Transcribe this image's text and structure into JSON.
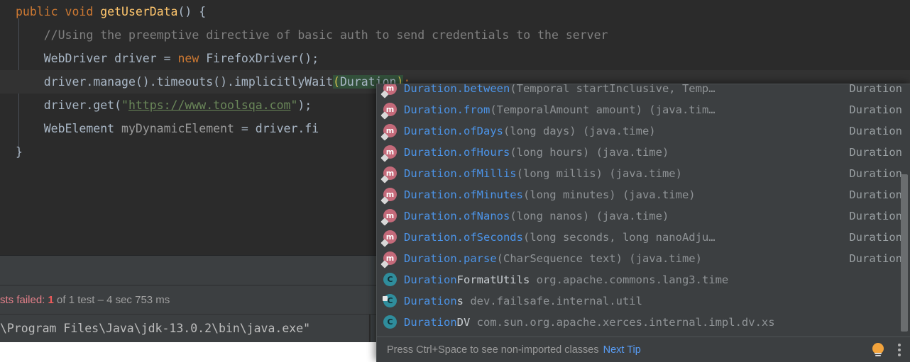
{
  "editor": {
    "lines": [
      {
        "id": "line-signature",
        "caret": false,
        "segments": [
          {
            "cls": "tok-kw",
            "text": "public void "
          },
          {
            "cls": "tok-method",
            "text": "getUserData"
          },
          {
            "cls": "tok-plain",
            "text": "() {"
          }
        ]
      },
      {
        "id": "line-comment",
        "caret": false,
        "segments": [
          {
            "cls": "tok-comment",
            "text": "    //Using the preemptive directive of basic auth to send credentials to the server"
          }
        ]
      },
      {
        "id": "line-webdriver",
        "caret": false,
        "segments": [
          {
            "cls": "tok-plain",
            "text": "    WebDriver driver = "
          },
          {
            "cls": "tok-kw",
            "text": "new"
          },
          {
            "cls": "tok-plain",
            "text": " FirefoxDriver();"
          }
        ]
      },
      {
        "id": "line-implicitlywait",
        "caret": true,
        "segments": [
          {
            "cls": "tok-plain",
            "text": "    driver.manage().timeouts().implicitlyWait"
          },
          {
            "cls": "tok-paren-h hl-param",
            "text": "("
          },
          {
            "cls": "tok-plain hl-param",
            "text": "Duration"
          },
          {
            "cls": "tok-paren-h hl-param",
            "text": ")"
          },
          {
            "cls": "tok-semi",
            "text": ";"
          }
        ]
      },
      {
        "id": "line-get-url",
        "caret": false,
        "segments": [
          {
            "cls": "tok-plain",
            "text": "    driver.get("
          },
          {
            "cls": "tok-str",
            "text": "\""
          },
          {
            "cls": "tok-url",
            "text": "https://www.toolsqa.com"
          },
          {
            "cls": "tok-str",
            "text": "\""
          },
          {
            "cls": "tok-plain",
            "text": ");"
          }
        ]
      },
      {
        "id": "line-webelement",
        "caret": false,
        "segments": [
          {
            "cls": "tok-plain",
            "text": "    WebElement "
          },
          {
            "cls": "tok-dim",
            "text": "myDynamicElement"
          },
          {
            "cls": "tok-plain",
            "text": " = driver.fi"
          }
        ]
      },
      {
        "id": "line-closing-brace",
        "caret": false,
        "segments": [
          {
            "cls": "tok-plain",
            "text": "}"
          }
        ]
      }
    ]
  },
  "test_results": {
    "failed_label": "sts failed: ",
    "failed_count": "1",
    "rest": " of 1 test – 4 sec 753 ms"
  },
  "console": {
    "output": "\\Program Files\\Java\\jdk-13.0.2\\bin\\java.exe\""
  },
  "completion": {
    "items": [
      {
        "icon": "method-icon",
        "kind": "method",
        "badge": "static",
        "match": "Duration",
        "name": ".between",
        "params": "(Temporal startInclusive, Temp…",
        "pkg": "",
        "type": "Duration"
      },
      {
        "icon": "method-icon",
        "kind": "method",
        "badge": "static",
        "match": "Duration",
        "name": ".from",
        "params": "(TemporalAmount amount) (java.tim…",
        "pkg": "",
        "type": "Duration"
      },
      {
        "icon": "method-icon",
        "kind": "method",
        "badge": "static",
        "match": "Duration",
        "name": ".ofDays",
        "params": "(long days) (java.time)",
        "pkg": "",
        "type": "Duration"
      },
      {
        "icon": "method-icon",
        "kind": "method",
        "badge": "static",
        "match": "Duration",
        "name": ".ofHours",
        "params": "(long hours) (java.time)",
        "pkg": "",
        "type": "Duration"
      },
      {
        "icon": "method-icon",
        "kind": "method",
        "badge": "static",
        "match": "Duration",
        "name": ".ofMillis",
        "params": "(long millis) (java.time)",
        "pkg": "",
        "type": "Duration"
      },
      {
        "icon": "method-icon",
        "kind": "method",
        "badge": "static",
        "match": "Duration",
        "name": ".ofMinutes",
        "params": "(long minutes) (java.time)",
        "pkg": "",
        "type": "Duration"
      },
      {
        "icon": "method-icon",
        "kind": "method",
        "badge": "static",
        "match": "Duration",
        "name": ".ofNanos",
        "params": "(long nanos) (java.time)",
        "pkg": "",
        "type": "Duration"
      },
      {
        "icon": "method-icon",
        "kind": "method",
        "badge": "static",
        "match": "Duration",
        "name": ".ofSeconds",
        "params": "(long seconds, long nanoAdju…",
        "pkg": "",
        "type": "Duration"
      },
      {
        "icon": "method-icon",
        "kind": "method",
        "badge": "static",
        "match": "Duration",
        "name": ".parse",
        "params": "(CharSequence text) (java.time)",
        "pkg": "",
        "type": "Duration"
      },
      {
        "icon": "class-icon",
        "kind": "class",
        "badge": "",
        "match": "Duration",
        "name": "FormatUtils",
        "params": "",
        "pkg": " org.apache.commons.lang3.time",
        "type": ""
      },
      {
        "icon": "class-icon",
        "kind": "class",
        "badge": "final",
        "match": "Duration",
        "name": "s",
        "params": "",
        "pkg": " dev.failsafe.internal.util",
        "type": ""
      },
      {
        "icon": "class-icon",
        "kind": "class",
        "badge": "",
        "match": "Duration",
        "name": "DV",
        "params": "",
        "pkg": " com.sun.org.apache.xerces.internal.impl.dv.xs",
        "type": ""
      }
    ],
    "footer": {
      "tip": "Press Ctrl+Space to see non-imported classes",
      "link": "Next Tip"
    }
  },
  "colors": {
    "editor_bg": "#2b2b2b",
    "panel_bg": "#3c3f41",
    "keyword": "#cc7832",
    "method": "#ffc66d",
    "string": "#6a8759",
    "match_blue": "#4c94e8",
    "link_blue": "#589df6",
    "fail_red": "#f05b5b",
    "bulb_yellow": "#f2a33c",
    "method_icon": "#c46a7a",
    "class_icon": "#2f8d9c"
  }
}
